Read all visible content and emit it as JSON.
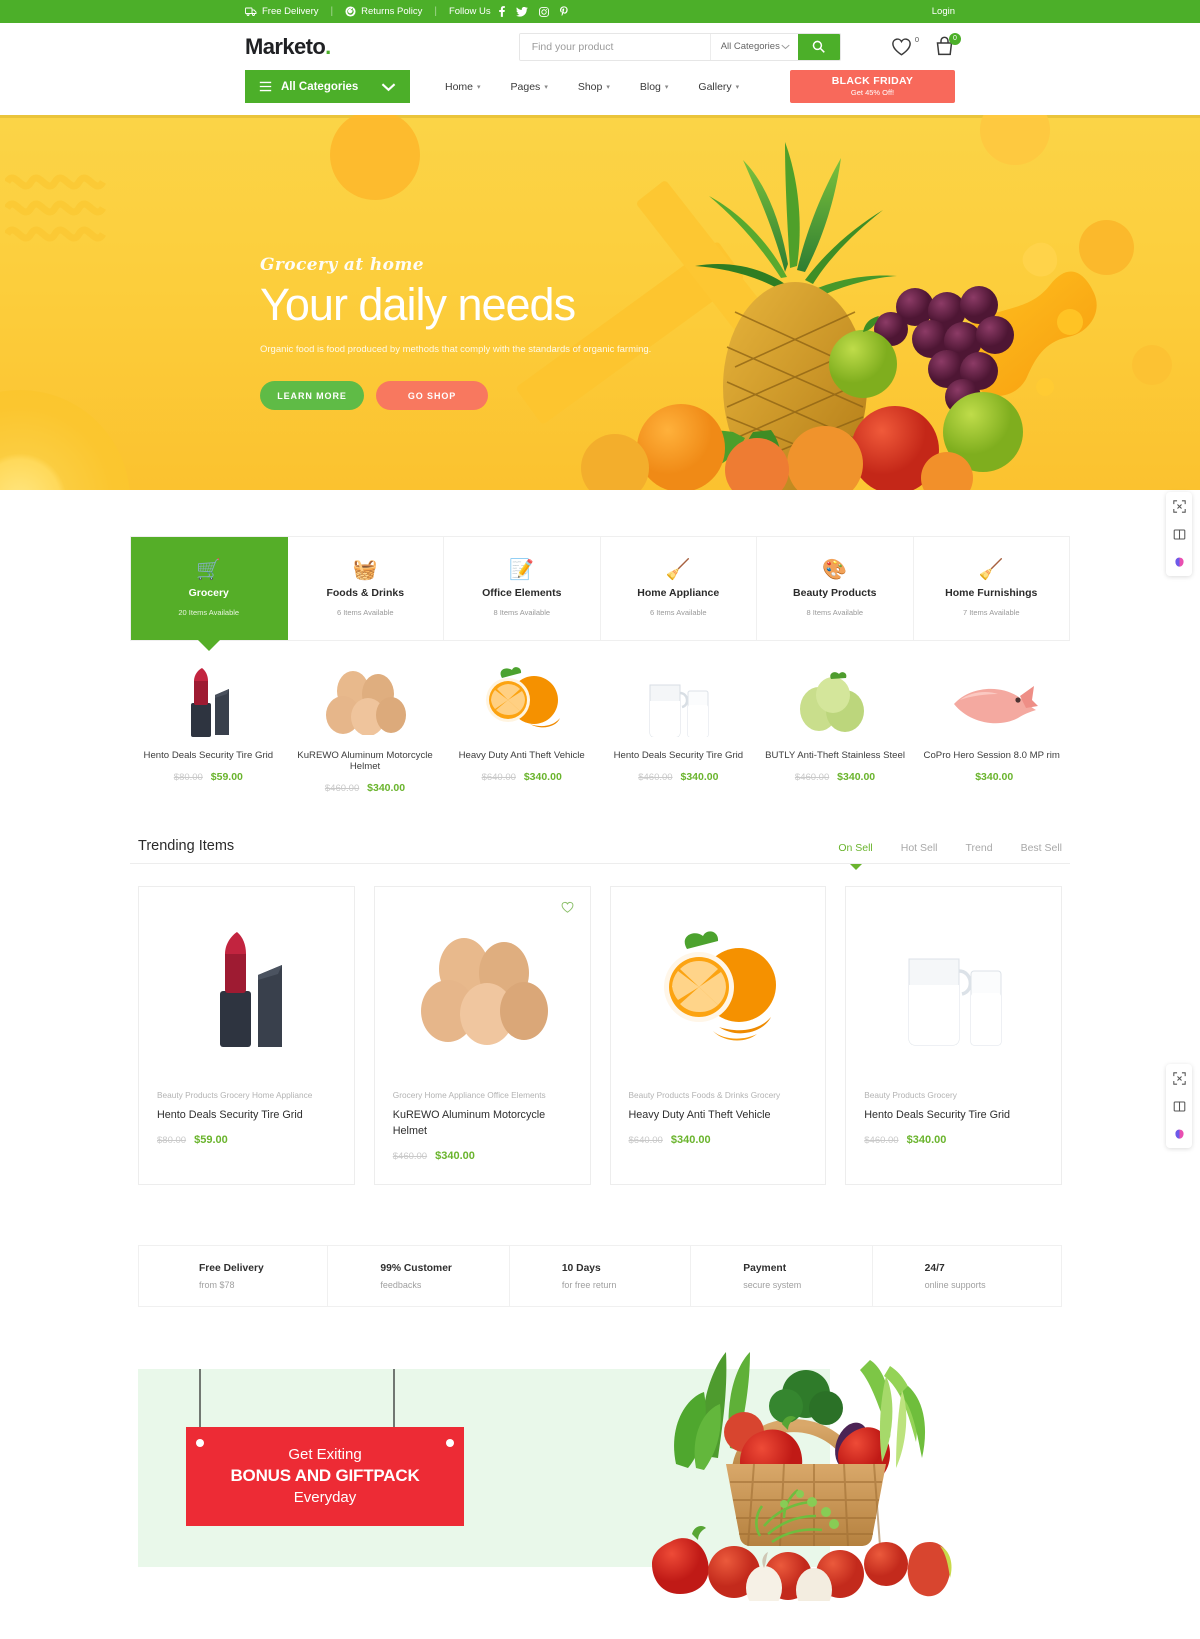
{
  "topbar": {
    "free_delivery": "Free Delivery",
    "returns_policy": "Returns Policy",
    "follow_us": "Follow Us",
    "separator": "|",
    "login": "Login",
    "socials": [
      "f",
      "𝕏",
      "▢",
      "P"
    ]
  },
  "header": {
    "logo_text": "Marketo",
    "logo_dot": ".",
    "search": {
      "placeholder": "Find your product",
      "value": "",
      "category_selected": "All Categories"
    },
    "wishlist_count": "0",
    "cart_count": "0"
  },
  "nav": {
    "all_categories": "All Categories",
    "menu": [
      {
        "label": "Home"
      },
      {
        "label": "Pages"
      },
      {
        "label": "Shop"
      },
      {
        "label": "Blog"
      },
      {
        "label": "Gallery"
      }
    ],
    "promo_button": {
      "line1": "BLACK FRIDAY",
      "line2": "Get 45% Off!"
    }
  },
  "hero": {
    "eyebrow": "Grocery at home",
    "title": "Your daily needs",
    "description": "Organic food is food produced by methods that comply with the standards of organic farming.",
    "btn_learn": "LEARN MORE",
    "btn_shop": "GO SHOP"
  },
  "categories": [
    {
      "name": "Grocery",
      "count": "20 Items Available",
      "icon": "grocery-bag-icon",
      "glyph": "🛒",
      "active": true
    },
    {
      "name": "Foods & Drinks",
      "count": "6 Items Available",
      "icon": "picnic-basket-icon",
      "glyph": "🧺",
      "active": false
    },
    {
      "name": "Office Elements",
      "count": "8 Items Available",
      "icon": "notepad-pencil-icon",
      "glyph": "📝",
      "active": false
    },
    {
      "name": "Home Appliance",
      "count": "6 Items Available",
      "icon": "broom-brush-icon",
      "glyph": "🧹",
      "active": false
    },
    {
      "name": "Beauty Products",
      "count": "8 Items Available",
      "icon": "makeup-palette-icon",
      "glyph": "🎨",
      "active": false
    },
    {
      "name": "Home Furnishings",
      "count": "7 Items Available",
      "icon": "broom-brush-icon",
      "glyph": "🧹",
      "active": false
    }
  ],
  "products": [
    {
      "title": "Hento Deals Security Tire Grid",
      "old_price": "$80.00",
      "price": "$59.00",
      "image": "lipstick-image"
    },
    {
      "title": "KuREWO Aluminum Motorcycle Helmet",
      "old_price": "$460.00",
      "price": "$340.00",
      "image": "eggs-image"
    },
    {
      "title": "Heavy Duty Anti Theft Vehicle",
      "old_price": "$640.00",
      "price": "$340.00",
      "image": "oranges-image"
    },
    {
      "title": "Hento Deals Security Tire Grid",
      "old_price": "$460.00",
      "price": "$340.00",
      "image": "milk-jug-image"
    },
    {
      "title": "BUTLY Anti-Theft Stainless Steel",
      "old_price": "$460.00",
      "price": "$340.00",
      "image": "guava-image"
    },
    {
      "title": "CoPro Hero Session 8.0 MP rim",
      "old_price": "",
      "price": "$340.00",
      "image": "fish-image"
    }
  ],
  "trending": {
    "title": "Trending Items",
    "tabs": [
      {
        "label": "On Sell",
        "active": true
      },
      {
        "label": "Hot Sell",
        "active": false
      },
      {
        "label": "Trend",
        "active": false
      },
      {
        "label": "Best Sell",
        "active": false
      }
    ],
    "cards": [
      {
        "categories": "Beauty Products Grocery Home Appliance",
        "name": "Hento Deals Security Tire Grid",
        "old_price": "$80.00",
        "price": "$59.00",
        "image": "lipstick-image",
        "wishlist": false
      },
      {
        "categories": "Grocery Home Appliance Office Elements",
        "name": "KuREWO Aluminum Motorcycle Helmet",
        "old_price": "$460.00",
        "price": "$340.00",
        "image": "eggs-image",
        "wishlist": true
      },
      {
        "categories": "Beauty Products Foods & Drinks Grocery",
        "name": "Heavy Duty Anti Theft Vehicle",
        "old_price": "$640.00",
        "price": "$340.00",
        "image": "oranges-image",
        "wishlist": false
      },
      {
        "categories": "Beauty Products Grocery",
        "name": "Hento Deals Security Tire Grid",
        "old_price": "$460.00",
        "price": "$340.00",
        "image": "milk-jug-image",
        "wishlist": false
      }
    ]
  },
  "features": [
    {
      "title": "Free Delivery",
      "sub": "from $78"
    },
    {
      "title": "99% Customer",
      "sub": "feedbacks"
    },
    {
      "title": "10 Days",
      "sub": "for free return"
    },
    {
      "title": "Payment",
      "sub": "secure system"
    },
    {
      "title": "24/7",
      "sub": "online supports"
    }
  ],
  "promo": {
    "line1": "Get Exiting",
    "line2": "BONUS AND GIFTPACK",
    "line3": "Everyday"
  },
  "float_widgets": [
    {
      "icon": "resize-icon"
    },
    {
      "icon": "book-icon"
    },
    {
      "icon": "brain-icon"
    }
  ],
  "colors": {
    "brand_green": "#4CAF29",
    "accent_red": "#F8695B",
    "hero_yellow": "#FBCE3C",
    "price_green": "#6AB42D",
    "promo_red": "#ED2B35",
    "promo_bg": "#E9F8EA"
  }
}
